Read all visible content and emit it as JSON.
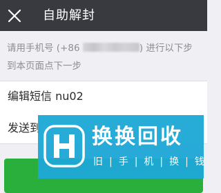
{
  "header": {
    "close_icon": "close-icon",
    "title": "自助解封"
  },
  "instruction": {
    "before_number": "请用手机号 (+86 ",
    "after_number": ") 进行以下步",
    "line2": "到本页面点下一步"
  },
  "form": {
    "sms_row_label": "编辑短信 nu02",
    "send_row_label": "发送到"
  },
  "watermark": {
    "logo_icon": "h-logo-icon",
    "brand_name": "换换回收",
    "slogan": "旧|手|机|换|钱"
  },
  "colors": {
    "titlebar": "#393a3f",
    "background": "#efeff4",
    "button_green": "#2aae3c",
    "watermark_blue": "#1fa8d6"
  }
}
